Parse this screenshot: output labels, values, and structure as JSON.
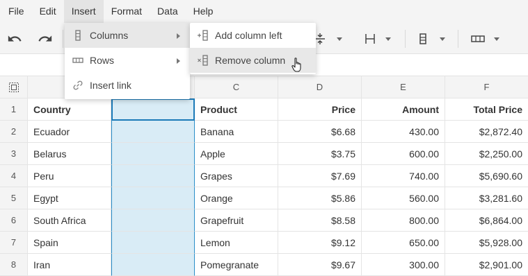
{
  "menubar": {
    "items": [
      "File",
      "Edit",
      "Insert",
      "Format",
      "Data",
      "Help"
    ],
    "active_index": 2
  },
  "toolbar": {
    "icons": [
      "undo-icon",
      "redo-icon",
      "vertical-align-icon",
      "column-width-icon",
      "column-icon",
      "row-icon"
    ]
  },
  "insert_menu": {
    "items": [
      {
        "label": "Columns",
        "icon": "columns-icon",
        "submenu": true
      },
      {
        "label": "Rows",
        "icon": "rows-icon",
        "submenu": true
      },
      {
        "label": "Insert link",
        "icon": "link-icon",
        "submenu": false
      }
    ]
  },
  "columns_submenu": {
    "items": [
      {
        "label": "Add column left",
        "icon": "add-column-left-icon"
      },
      {
        "label": "Remove column",
        "icon": "remove-column-icon"
      }
    ]
  },
  "grid": {
    "select_all_icon": "select-all-icon",
    "col_headers": [
      "",
      "",
      "C",
      "D",
      "E",
      "F"
    ],
    "row_numbers": [
      "1",
      "2",
      "3",
      "4",
      "5",
      "6",
      "7",
      "8"
    ],
    "rows": [
      [
        "Country",
        "",
        "Product",
        "Price",
        "Amount",
        "Total Price"
      ],
      [
        "Ecuador",
        "",
        "Banana",
        "$6.68",
        "430.00",
        "$2,872.40"
      ],
      [
        "Belarus",
        "",
        "Apple",
        "$3.75",
        "600.00",
        "$2,250.00"
      ],
      [
        "Peru",
        "",
        "Grapes",
        "$7.69",
        "740.00",
        "$5,690.60"
      ],
      [
        "Egypt",
        "",
        "Orange",
        "$5.86",
        "560.00",
        "$3,281.60"
      ],
      [
        "South Africa",
        "",
        "Grapefruit",
        "$8.58",
        "800.00",
        "$6,864.00"
      ],
      [
        "Spain",
        "",
        "Lemon",
        "$9.12",
        "650.00",
        "$5,928.00"
      ],
      [
        "Iran",
        "",
        "Pomegranate",
        "$9.67",
        "300.00",
        "$2,901.00"
      ]
    ]
  },
  "colors": {
    "selection_fill": "#d9ecf6",
    "selection_border": "#1b7ab8"
  }
}
